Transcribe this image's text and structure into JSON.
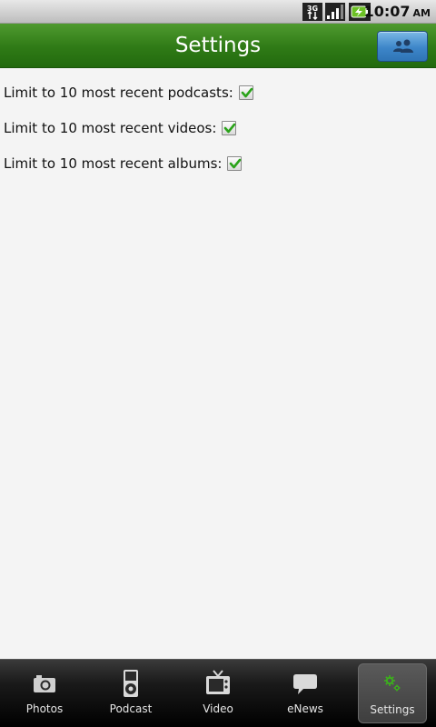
{
  "status_bar": {
    "network": "3G",
    "time": "10:07",
    "ampm": "AM"
  },
  "header": {
    "title": "Settings"
  },
  "settings": [
    {
      "label": "Limit to 10 most recent podcasts:",
      "checked": true
    },
    {
      "label": "Limit to 10 most recent videos:",
      "checked": true
    },
    {
      "label": "Limit to 10 most recent albums:",
      "checked": true
    }
  ],
  "tabs": [
    {
      "label": "Photos",
      "icon": "camera-icon",
      "active": false
    },
    {
      "label": "Podcast",
      "icon": "ipod-icon",
      "active": false
    },
    {
      "label": "Video",
      "icon": "tv-icon",
      "active": false
    },
    {
      "label": "eNews",
      "icon": "speech-bubble-icon",
      "active": false
    },
    {
      "label": "Settings",
      "icon": "gear-icon",
      "active": true
    }
  ],
  "colors": {
    "title_bar": "#2f7a16",
    "checkmark": "#2aa31a",
    "people_button": "#3d86c9"
  }
}
